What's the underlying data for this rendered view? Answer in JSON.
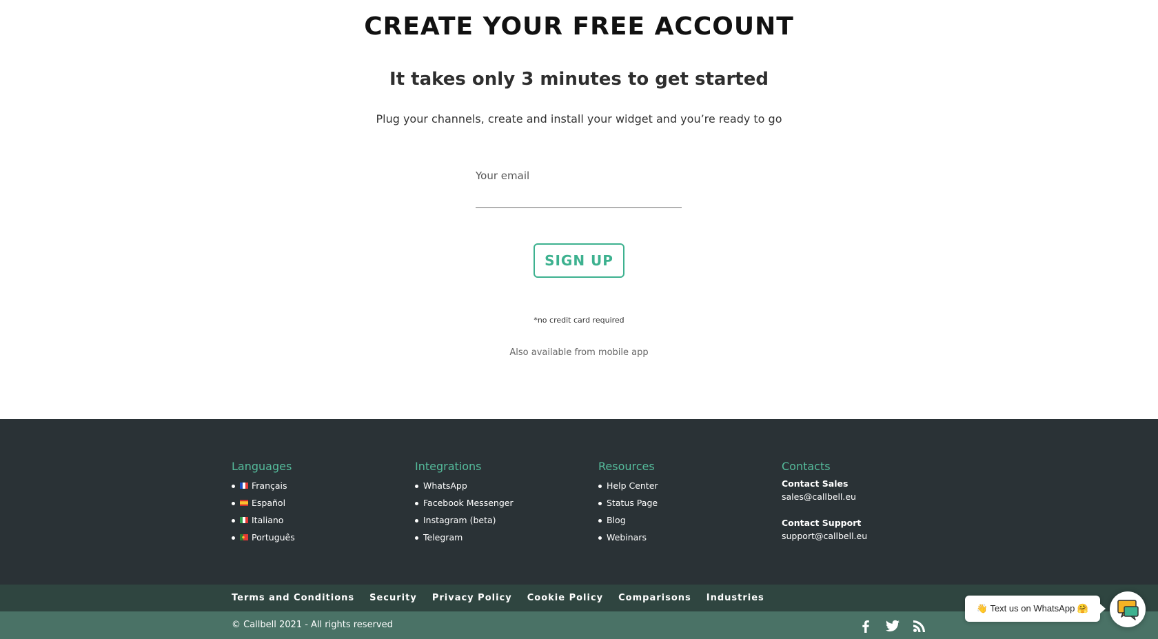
{
  "hero": {
    "title": "Create your free account",
    "subtitle": "It takes only 3 minutes to get started",
    "description": "Plug your channels, create and install your widget and you’re ready to go",
    "email_label": "Your email",
    "email_value": "",
    "signup_label": "Sign up",
    "no_credit_card": "*no credit card required",
    "mobile_note": "Also available from mobile app"
  },
  "footer": {
    "languages": {
      "title": "Languages",
      "items": [
        {
          "label": "Français",
          "flag": "fr-flag-icon"
        },
        {
          "label": "Español",
          "flag": "es-flag-icon"
        },
        {
          "label": "Italiano",
          "flag": "it-flag-icon"
        },
        {
          "label": "Português",
          "flag": "pt-flag-icon"
        }
      ]
    },
    "integrations": {
      "title": "Integrations",
      "items": [
        "WhatsApp",
        "Facebook Messenger",
        "Instagram (beta)",
        "Telegram"
      ]
    },
    "resources": {
      "title": "Resources",
      "items": [
        "Help Center",
        "Status Page",
        "Blog",
        "Webinars"
      ]
    },
    "contacts": {
      "title": "Contacts",
      "sales_label": "Contact Sales",
      "sales_email": "sales@callbell.eu",
      "support_label": "Contact Support",
      "support_email": "support@callbell.eu"
    },
    "legal_links": [
      "Terms and Conditions",
      "Security",
      "Privacy Policy",
      "Cookie Policy",
      "Comparisons",
      "Industries"
    ],
    "copyright": "© Callbell 2021 - All rights reserved",
    "social": [
      "facebook-icon",
      "twitter-icon",
      "rss-icon"
    ]
  },
  "whatsapp_widget": {
    "label": "👋 Text us on WhatsApp 🤗"
  },
  "colors": {
    "accent": "#3db18f",
    "footer_bg": "#2a3236",
    "legal_bar_bg": "#2f4540",
    "bottom_bar_bg": "#4a7266",
    "footer_heading": "#55bc9c"
  }
}
